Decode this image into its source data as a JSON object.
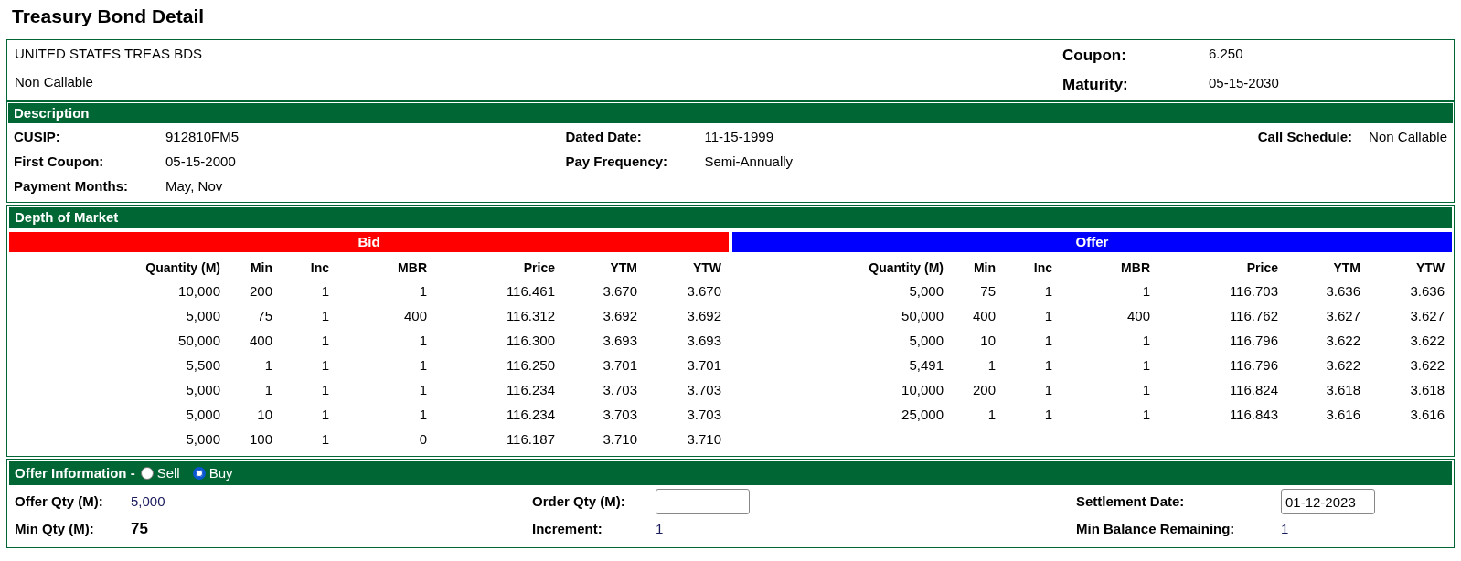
{
  "page_title": "Treasury Bond Detail",
  "bond": {
    "name": "UNITED STATES TREAS BDS",
    "call_status": "Non Callable",
    "fields": [
      {
        "label": "Coupon:",
        "value": "6.250"
      },
      {
        "label": "Maturity:",
        "value": "05-15-2030"
      }
    ]
  },
  "description": {
    "title": "Description",
    "columns": [
      [
        {
          "label": "CUSIP:",
          "value": "912810FM5"
        },
        {
          "label": "First Coupon:",
          "value": "05-15-2000"
        },
        {
          "label": "Payment Months:",
          "value": "May, Nov"
        }
      ],
      [
        {
          "label": "Dated Date:",
          "value": "11-15-1999"
        },
        {
          "label": "Pay Frequency:",
          "value": "Semi-Annually"
        }
      ],
      [
        {
          "label": "Call Schedule:",
          "value": "Non Callable"
        }
      ]
    ]
  },
  "depth_of_market": {
    "title": "Depth of Market",
    "sides": [
      {
        "label": "Bid",
        "color": "#ff0000",
        "columns": [
          "Quantity (M)",
          "Min",
          "Inc",
          "MBR",
          "Price",
          "YTM",
          "YTW"
        ],
        "rows": [
          [
            "10,000",
            "200",
            "1",
            "1",
            "116.461",
            "3.670",
            "3.670"
          ],
          [
            "5,000",
            "75",
            "1",
            "400",
            "116.312",
            "3.692",
            "3.692"
          ],
          [
            "50,000",
            "400",
            "1",
            "1",
            "116.300",
            "3.693",
            "3.693"
          ],
          [
            "5,500",
            "1",
            "1",
            "1",
            "116.250",
            "3.701",
            "3.701"
          ],
          [
            "5,000",
            "1",
            "1",
            "1",
            "116.234",
            "3.703",
            "3.703"
          ],
          [
            "5,000",
            "10",
            "1",
            "1",
            "116.234",
            "3.703",
            "3.703"
          ],
          [
            "5,000",
            "100",
            "1",
            "0",
            "116.187",
            "3.710",
            "3.710"
          ]
        ]
      },
      {
        "label": "Offer",
        "color": "#0000ff",
        "columns": [
          "Quantity (M)",
          "Min",
          "Inc",
          "MBR",
          "Price",
          "YTM",
          "YTW"
        ],
        "rows": [
          [
            "5,000",
            "75",
            "1",
            "1",
            "116.703",
            "3.636",
            "3.636"
          ],
          [
            "50,000",
            "400",
            "1",
            "400",
            "116.762",
            "3.627",
            "3.627"
          ],
          [
            "5,000",
            "10",
            "1",
            "1",
            "116.796",
            "3.622",
            "3.622"
          ],
          [
            "5,491",
            "1",
            "1",
            "1",
            "116.796",
            "3.622",
            "3.622"
          ],
          [
            "10,000",
            "200",
            "1",
            "1",
            "116.824",
            "3.618",
            "3.618"
          ],
          [
            "25,000",
            "1",
            "1",
            "1",
            "116.843",
            "3.616",
            "3.616"
          ]
        ]
      }
    ]
  },
  "offer_information": {
    "title": "Offer Information -",
    "options": [
      {
        "label": "Sell",
        "selected": false
      },
      {
        "label": "Buy",
        "selected": true
      }
    ],
    "columns": [
      [
        {
          "label": "Offer Qty (M):",
          "kind": "text",
          "value": "5,000"
        },
        {
          "label": "Min Qty (M):",
          "kind": "strong",
          "value": "75"
        }
      ],
      [
        {
          "label": "Order Qty (M):",
          "kind": "input"
        },
        {
          "label": "Increment:",
          "kind": "text",
          "value": "1"
        }
      ],
      [
        {
          "label": "Settlement Date:",
          "kind": "input",
          "value": "01-12-2023"
        },
        {
          "label": "Min Balance Remaining:",
          "kind": "text",
          "value": "1"
        }
      ]
    ]
  }
}
